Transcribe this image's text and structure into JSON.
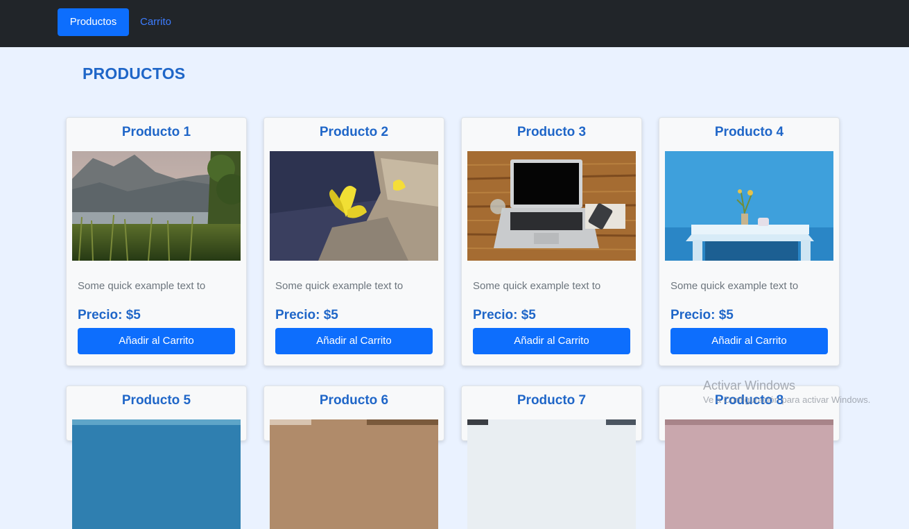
{
  "nav": {
    "productos_label": "Productos",
    "carrito_label": "Carrito"
  },
  "page": {
    "title": "PRODUCTOS"
  },
  "products": [
    {
      "title": "Producto 1",
      "text": "Some quick example text to",
      "price": "Precio: $5",
      "button": "Añadir al Carrito",
      "image": "lake-landscape"
    },
    {
      "title": "Producto 2",
      "text": "Some quick example text to",
      "price": "Precio: $5",
      "button": "Añadir al Carrito",
      "image": "yellow-flower-on-wood"
    },
    {
      "title": "Producto 3",
      "text": "Some quick example text to",
      "price": "Precio: $5",
      "button": "Añadir al Carrito",
      "image": "laptop-on-desk"
    },
    {
      "title": "Producto 4",
      "text": "Some quick example text to",
      "price": "Precio: $5",
      "button": "Añadir al Carrito",
      "image": "blue-wall-table"
    },
    {
      "title": "Producto 5",
      "image": "sea-landscape"
    },
    {
      "title": "Producto 6",
      "image": "warm-photo"
    },
    {
      "title": "Producto 7",
      "image": "dark-photo"
    },
    {
      "title": "Producto 8",
      "image": "pink-flowers"
    }
  ],
  "watermark": {
    "title": "Activar Windows",
    "subtitle": "Ve a Configuración para activar Windows."
  },
  "colors": {
    "navbar": "#212529",
    "primary": "#0d6efd",
    "heading": "#1f66c8",
    "background": "#eaf2ff"
  }
}
